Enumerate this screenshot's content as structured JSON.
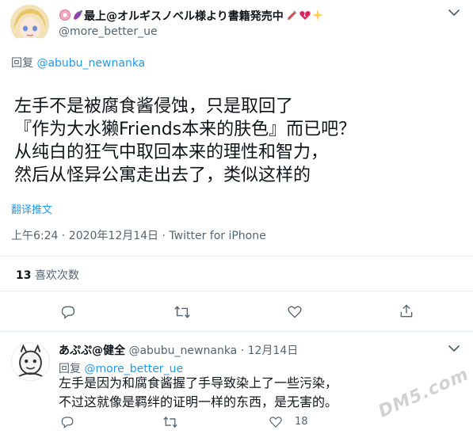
{
  "tweet": {
    "author": {
      "display_name": "最上@オルギスノベル様より書籍発売中",
      "handle": "@more_better_ue"
    },
    "reply_label": "回复",
    "reply_to": "@abubu_newnanka",
    "text_lines": [
      "左手不是被腐食酱侵蚀，只是取回了",
      "『作为大水獭Friends本来的肤色』而已吧？",
      "从纯白的狂气中取回本来的理性和智力，",
      "然后从怪异公寓走出去了，类似这样的"
    ],
    "translate_label": "翻译推文",
    "timestamp": "上午6:24 · 2020年12月14日 · Twitter for iPhone",
    "likes_count": "13",
    "likes_label": "喜欢次数"
  },
  "reply": {
    "author": {
      "display_name": "あぷぷ@健全",
      "handle": "@abubu_newnanka",
      "date": "· 12月14日"
    },
    "reply_label": "回复",
    "reply_to": "@more_better_ue",
    "text_lines": [
      "左手是因为和腐食酱握了手导致染上了一些污染，",
      "不过这就像是羁绊的证明一样的东西，是无害的。"
    ],
    "likes_count": "18"
  },
  "watermark": "DM5.com",
  "colors": {
    "text": "#0f1419",
    "muted": "#536471",
    "link": "#1d9bf0",
    "divider": "#e6ecf0"
  }
}
